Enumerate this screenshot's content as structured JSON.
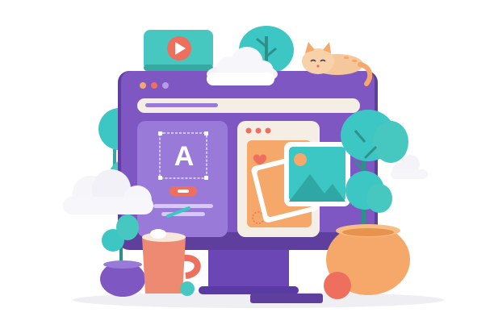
{
  "illustration": {
    "editor_panel": {
      "glyph": "A"
    },
    "colors": {
      "monitor_frame": "#7e57c2",
      "monitor_dark": "#5e3f9e",
      "panel_purple": "#9a7ad8",
      "teal": "#3cc6c4",
      "teal_light": "#7fe2dc",
      "orange": "#f5a86a",
      "coral": "#ef6f5e",
      "cream": "#f4eee4"
    },
    "icons": [
      "video-play-icon",
      "image-icon",
      "heart-icon",
      "cat-figure",
      "cloud-icon",
      "tree-icon",
      "mug-icon",
      "plant-pot-icon"
    ]
  }
}
